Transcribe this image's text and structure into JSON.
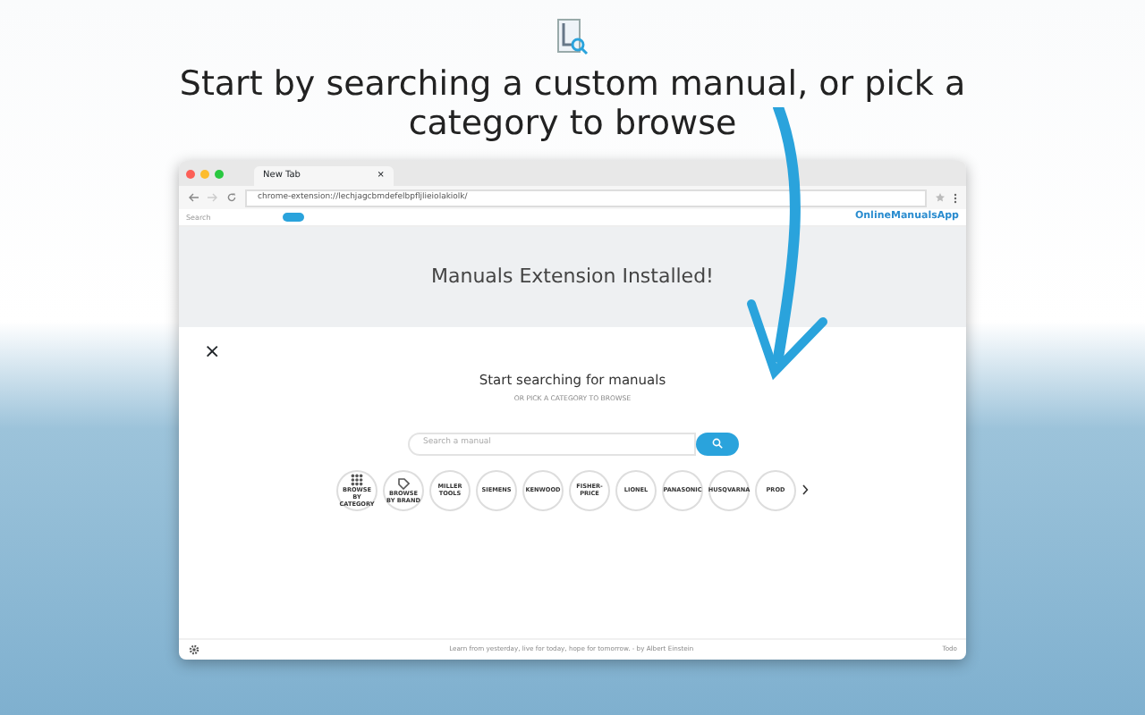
{
  "headline": "Start by searching a custom manual, or pick a category to browse",
  "browser": {
    "tab_title": "New Tab",
    "tab_close": "×",
    "address": "chrome-extension://lechjagcbmdefelbpfljlieiolakiolk/"
  },
  "toolbar": {
    "search_placeholder": "Search",
    "brand": "OnlineManualsApp"
  },
  "banner": {
    "title": "Manuals Extension Installed!"
  },
  "panel": {
    "close": "×",
    "title": "Start searching for manuals",
    "subtitle": "OR PICK A CATEGORY TO BROWSE",
    "search_placeholder": "Search a manual"
  },
  "categories": [
    {
      "kind": "icon",
      "label": "BROWSE BY CATEGORY"
    },
    {
      "kind": "icon",
      "label": "BROWSE BY BRAND"
    },
    {
      "kind": "brand",
      "label": "MILLER TOOLS"
    },
    {
      "kind": "brand",
      "label": "SIEMENS"
    },
    {
      "kind": "brand",
      "label": "KENWOOD"
    },
    {
      "kind": "brand",
      "label": "FISHER-PRICE"
    },
    {
      "kind": "brand",
      "label": "LIONEL"
    },
    {
      "kind": "brand",
      "label": "PANASONIC"
    },
    {
      "kind": "brand",
      "label": "HUSQVARNA"
    },
    {
      "kind": "brand",
      "label": "PROD"
    }
  ],
  "footer": {
    "quote": "Learn from yesterday, live for today, hope for tomorrow. - by Albert Einstein",
    "todo": "Todo"
  }
}
